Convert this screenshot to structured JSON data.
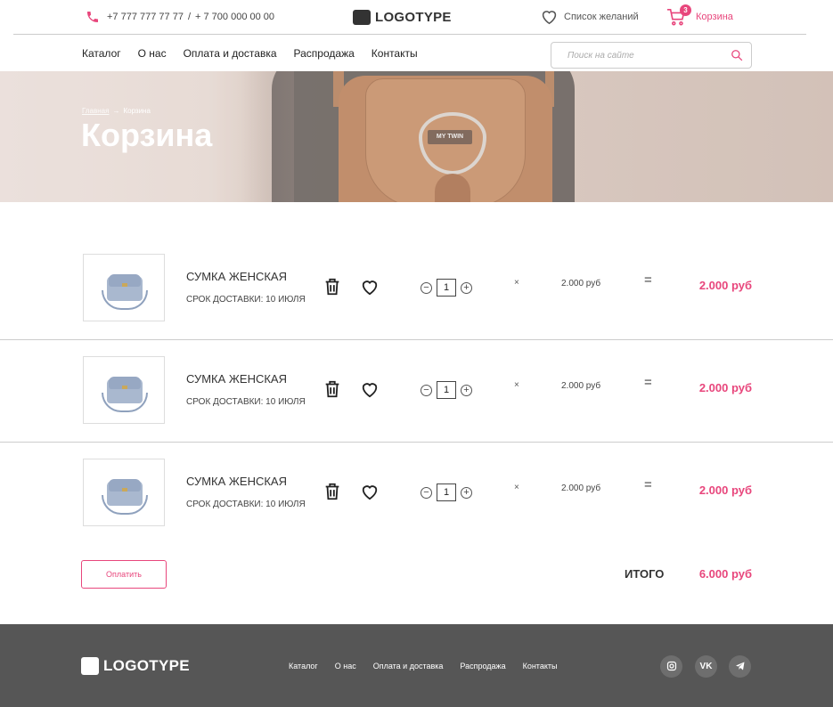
{
  "colors": {
    "accent": "#e8467c",
    "footer": "#565656"
  },
  "header": {
    "phone_1": "+7 777 777 77 77",
    "separator": "/",
    "phone_2": "+ 7 700 000 00 00",
    "logo": "LOGOTYPE",
    "wishlist_label": "Список желаний",
    "cart_label": "Корзина",
    "cart_count": "3"
  },
  "nav": {
    "items": [
      "Каталог",
      "О нас",
      "Оплата и доставка",
      "Распродажа",
      "Контакты"
    ],
    "search_placeholder": "Поиск на сайте"
  },
  "hero": {
    "breadcrumb_home": "Главная",
    "breadcrumb_arrow": "→",
    "breadcrumb_current": "Корзина",
    "title": "Корзина",
    "bag_plate": "MY TWIN"
  },
  "cart": {
    "items": [
      {
        "name": "СУМКА ЖЕНСКАЯ",
        "delivery": "СРОК ДОСТАВКИ: 10 ИЮЛЯ",
        "qty": "1",
        "times": "×",
        "unit_price": "2.000 руб",
        "equals": "=",
        "sum": "2.000 руб"
      },
      {
        "name": "СУМКА ЖЕНСКАЯ",
        "delivery": "СРОК ДОСТАВКИ: 10 ИЮЛЯ",
        "qty": "1",
        "times": "×",
        "unit_price": "2.000 руб",
        "equals": "=",
        "sum": "2.000 руб"
      },
      {
        "name": "СУМКА ЖЕНСКАЯ",
        "delivery": "СРОК ДОСТАВКИ: 10 ИЮЛЯ",
        "qty": "1",
        "times": "×",
        "unit_price": "2.000 руб",
        "equals": "=",
        "sum": "2.000 руб"
      }
    ],
    "minus": "−",
    "plus": "+",
    "pay_label": "Оплатить",
    "total_label": "ИТОГО",
    "total_value": "6.000 руб"
  },
  "footer": {
    "logo": "LOGOTYPE",
    "menu": [
      "Каталог",
      "О нас",
      "Оплата и доставка",
      "Распродажа",
      "Контакты"
    ],
    "social": [
      "instagram-icon",
      "vk-icon",
      "telegram-icon"
    ],
    "vk_text": "VK"
  }
}
